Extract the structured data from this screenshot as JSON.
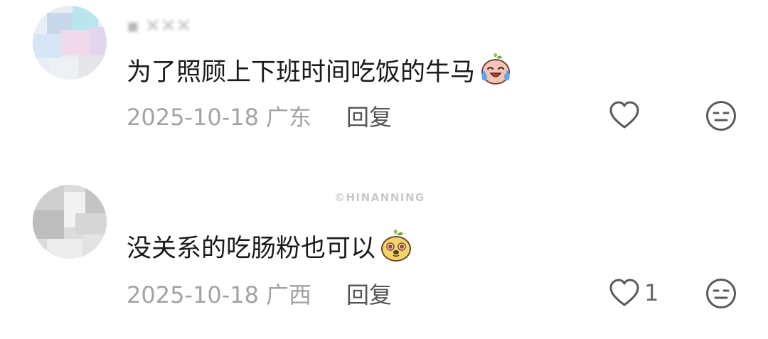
{
  "comments": [
    {
      "username": "▪ ✕✕✕",
      "text": "为了照顾上下班时间吃饭的牛马",
      "emoji": "crying-laughing-face-emoji",
      "date": "2025-10-18",
      "location": "广东",
      "reply_label": "回复",
      "like_count": ""
    },
    {
      "username": "",
      "text": "没关系的吃肠粉也可以",
      "emoji": "smug-face-emoji",
      "date": "2025-10-18",
      "location": "广西",
      "reply_label": "回复",
      "like_count": "1"
    }
  ],
  "watermark": "©HINANNING",
  "colors": {
    "text": "#1a1a1a",
    "meta": "#a3a3a3",
    "icon": "#5a5a5a"
  }
}
